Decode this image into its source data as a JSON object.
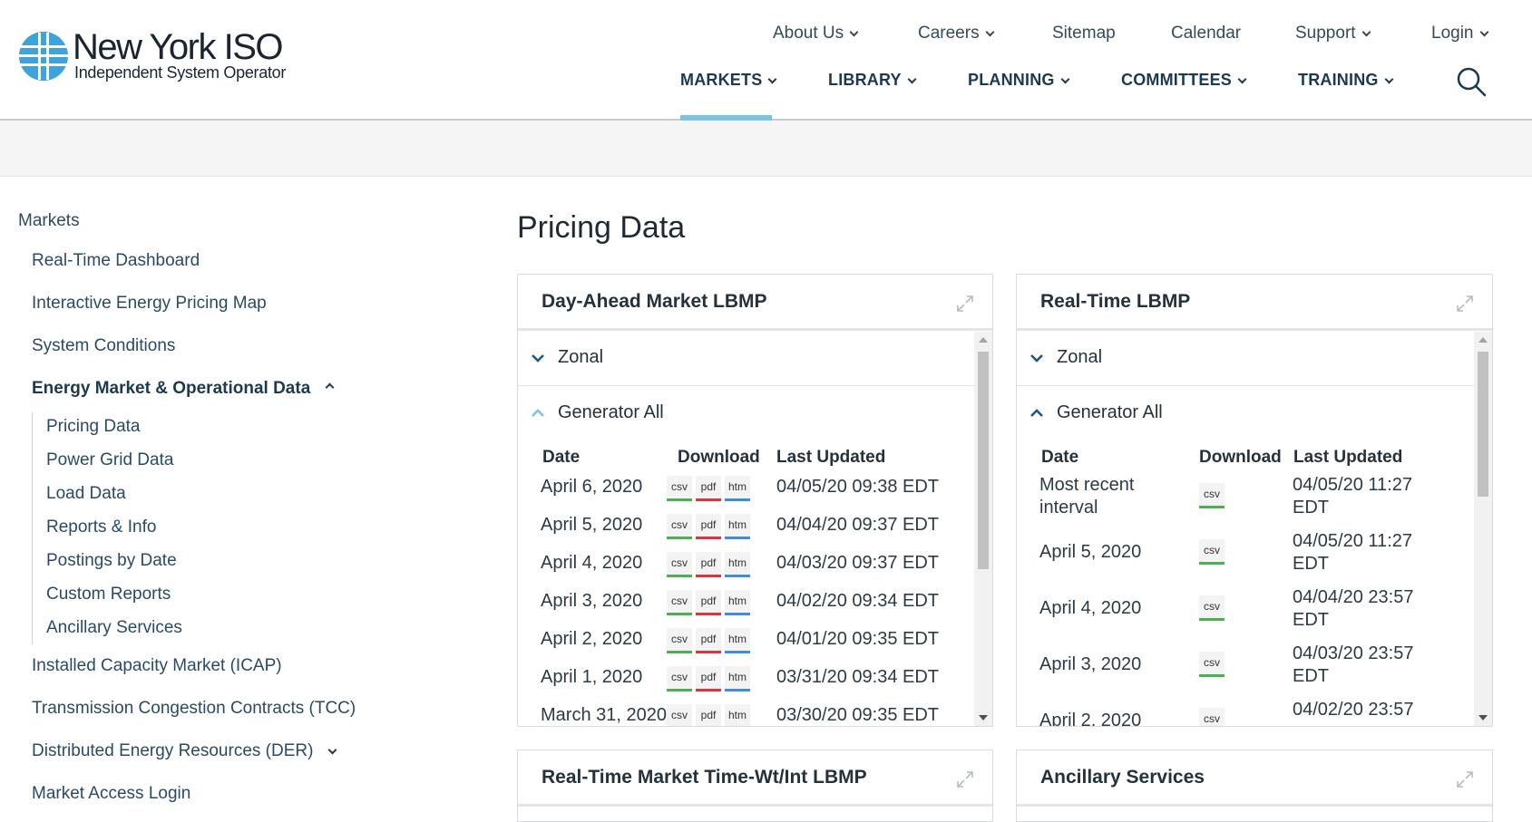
{
  "logo": {
    "title": "New York ISO",
    "subtitle": "Independent System Operator"
  },
  "util_nav": [
    {
      "label": "About Us",
      "has_menu": true
    },
    {
      "label": "Careers",
      "has_menu": true
    },
    {
      "label": "Sitemap",
      "has_menu": false
    },
    {
      "label": "Calendar",
      "has_menu": false
    },
    {
      "label": "Support",
      "has_menu": true
    },
    {
      "label": "Login",
      "has_menu": true
    }
  ],
  "main_nav": [
    "MARKETS",
    "LIBRARY",
    "PLANNING",
    "COMMITTEES",
    "TRAINING"
  ],
  "main_nav_active": "MARKETS",
  "sidebar": {
    "root": "Markets",
    "items": [
      "Real-Time Dashboard",
      "Interactive Energy Pricing Map",
      "System Conditions",
      "Energy Market & Operational Data"
    ],
    "subitems": [
      "Pricing Data",
      "Power Grid Data",
      "Load Data",
      "Reports & Info",
      "Postings by Date",
      "Custom Reports",
      "Ancillary Services"
    ],
    "after_items": [
      "Installed Capacity Market (ICAP)",
      "Transmission Congestion Contracts (TCC)",
      "Distributed Energy Resources (DER)",
      "Market Access Login"
    ]
  },
  "page_title": "Pricing Data",
  "panels": {
    "dam": {
      "title": "Day-Ahead Market LBMP",
      "sections": [
        "Zonal",
        "Generator All"
      ],
      "headers": [
        "Date",
        "Download",
        "Last Updated"
      ],
      "rows": [
        {
          "date": "April 6, 2020",
          "updated": "04/05/20 09:38 EDT"
        },
        {
          "date": "April 5, 2020",
          "updated": "04/04/20 09:37 EDT"
        },
        {
          "date": "April 4, 2020",
          "updated": "04/03/20 09:37 EDT"
        },
        {
          "date": "April 3, 2020",
          "updated": "04/02/20 09:34 EDT"
        },
        {
          "date": "April 2, 2020",
          "updated": "04/01/20 09:35 EDT"
        },
        {
          "date": "April 1, 2020",
          "updated": "03/31/20 09:34 EDT"
        },
        {
          "date": "March 31, 2020",
          "updated": "03/30/20 09:35 EDT"
        }
      ],
      "formats": [
        "csv",
        "pdf",
        "htm"
      ]
    },
    "rt": {
      "title": "Real-Time LBMP",
      "sections": [
        "Zonal",
        "Generator All"
      ],
      "headers": [
        "Date",
        "Download",
        "Last Updated"
      ],
      "rows": [
        {
          "date": "Most recent interval",
          "updated": "04/05/20 11:27 EDT"
        },
        {
          "date": "April 5, 2020",
          "updated": "04/05/20 11:27 EDT"
        },
        {
          "date": "April 4, 2020",
          "updated": "04/04/20 23:57 EDT"
        },
        {
          "date": "April 3, 2020",
          "updated": "04/03/20 23:57 EDT"
        },
        {
          "date": "April 2, 2020",
          "updated": "04/02/20 23:57"
        }
      ],
      "formats": [
        "csv"
      ]
    },
    "rt_tw": {
      "title": "Real-Time Market Time-Wt/Int LBMP"
    },
    "anc": {
      "title": "Ancillary Services"
    }
  },
  "colors": {
    "accent": "#7cc3e6",
    "nav_text": "#1b3a52",
    "csv": "#4caf50",
    "pdf": "#d9363e",
    "htm": "#3a8fd6"
  },
  "icons": {
    "search": "search-icon",
    "expand": "expand-icon",
    "logo": "globe-logo-icon"
  }
}
